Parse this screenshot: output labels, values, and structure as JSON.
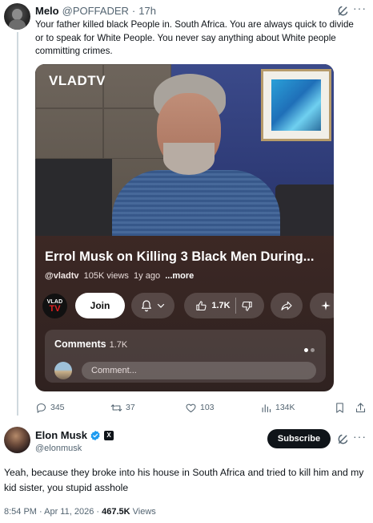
{
  "reply": {
    "name": "Melo",
    "handle": "@POFFADER",
    "separator": "·",
    "time": "17h",
    "more_glyph": "···",
    "text": "Your father killed black People in. South Africa. You are always quick to divide or to speak for White People. You never say anything about White people committing crimes.",
    "actions": {
      "replies": "345",
      "reposts": "37",
      "likes": "103",
      "views": "134K"
    }
  },
  "video": {
    "logo_text": "VLADTV",
    "title": "Errol Musk on Killing 3 Black Men During...",
    "channel": "@vladtv",
    "views": "105K views",
    "age": "1y ago",
    "more_label": "...more",
    "channel_icon": {
      "line1": "VLAD",
      "line2": "TV"
    },
    "join_label": "Join",
    "like_count": "1.7K",
    "comments": {
      "label": "Comments",
      "count": "1.7K",
      "placeholder": "Comment..."
    }
  },
  "main": {
    "name": "Elon Musk",
    "handle": "@elonmusk",
    "badge_glyph": "X",
    "subscribe_label": "Subscribe",
    "more_glyph": "···",
    "text": "Yeah, because they broke into his house in South Africa and tried to kill him and my kid sister, you stupid asshole",
    "timestamp": "8:54 PM · Apr 11, 2026 · ",
    "views_count": "467.5K",
    "views_label": "Views"
  },
  "colors": {
    "verified_blue": "#1d9bf0",
    "text_primary": "#0f1419",
    "text_secondary": "#536471",
    "card_bg": "#3a2724"
  },
  "icons": [
    "grok-icon",
    "more-icon",
    "reply-icon",
    "repost-icon",
    "like-icon",
    "views-icon",
    "bookmark-icon",
    "share-icon",
    "bell-icon",
    "chevron-down-icon",
    "thumb-up-icon",
    "thumb-down-icon",
    "youtube-share-icon",
    "sparkle-icon",
    "verified-icon"
  ]
}
